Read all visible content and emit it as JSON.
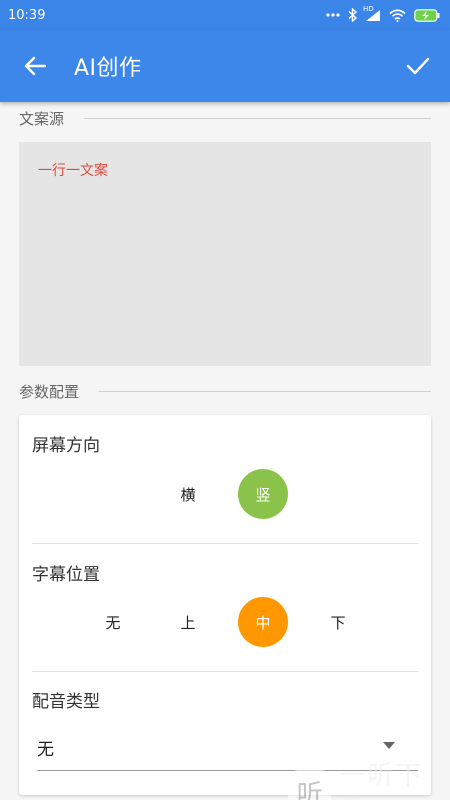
{
  "status_bar": {
    "time": "10:39",
    "network": "HD"
  },
  "app_bar": {
    "title": "AI创作",
    "back_icon": "arrow-left-icon",
    "confirm_icon": "check-icon"
  },
  "copy_section": {
    "header": "文案源",
    "text": "一行一文案"
  },
  "params_section": {
    "header": "参数配置",
    "screen_orientation": {
      "label": "屏幕方向",
      "options": [
        "横",
        "竖"
      ],
      "selected": "竖"
    },
    "subtitle_position": {
      "label": "字幕位置",
      "options": [
        "无",
        "上",
        "中",
        "下"
      ],
      "selected": "中"
    },
    "voice_type": {
      "label": "配音类型",
      "value": "无"
    }
  },
  "watermark": {
    "logo_char": "听",
    "text": "一听下载"
  },
  "colors": {
    "primary": "#3d86ea",
    "green": "#8bc34a",
    "orange": "#ff9800",
    "copy_text": "#e04b3a"
  }
}
